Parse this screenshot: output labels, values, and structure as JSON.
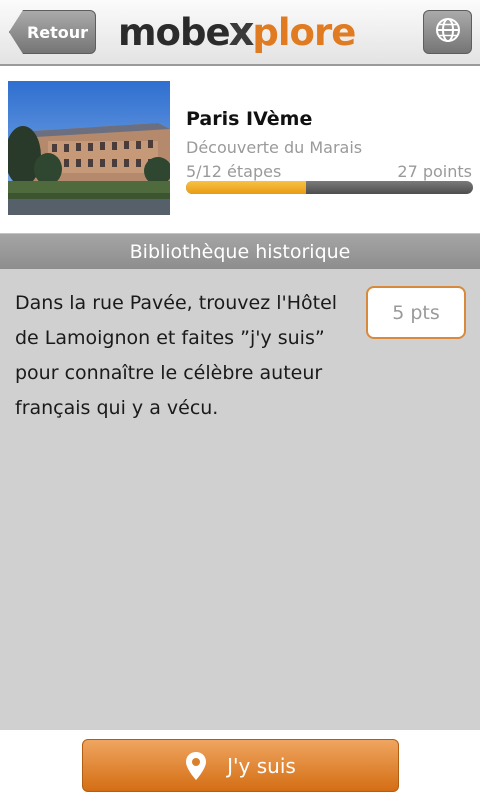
{
  "header": {
    "back_label": "Retour",
    "logo": {
      "part1": "mobe",
      "x": "x",
      "part2": "plore"
    },
    "globe_icon": "globe-icon"
  },
  "tour": {
    "title": "Paris IVème",
    "subtitle": "Découverte du Marais",
    "steps": "5/12 étapes",
    "points": "27 points",
    "progress_fraction": 0.41667
  },
  "section": {
    "title": "Bibliothèque historique"
  },
  "challenge": {
    "text": "Dans la rue Pavée, trouvez l'Hôtel de Lamoignon et faites ”j'y suis” pour connaître le célèbre auteur français qui y a vécu.",
    "points_badge": "5 pts"
  },
  "footer": {
    "button_label": "J'y suis",
    "button_icon": "map-pin-icon"
  },
  "colors": {
    "accent_orange": "#e07b21",
    "progress_fill": "#f0ac2a",
    "panel_bg": "#d0d0d0"
  }
}
